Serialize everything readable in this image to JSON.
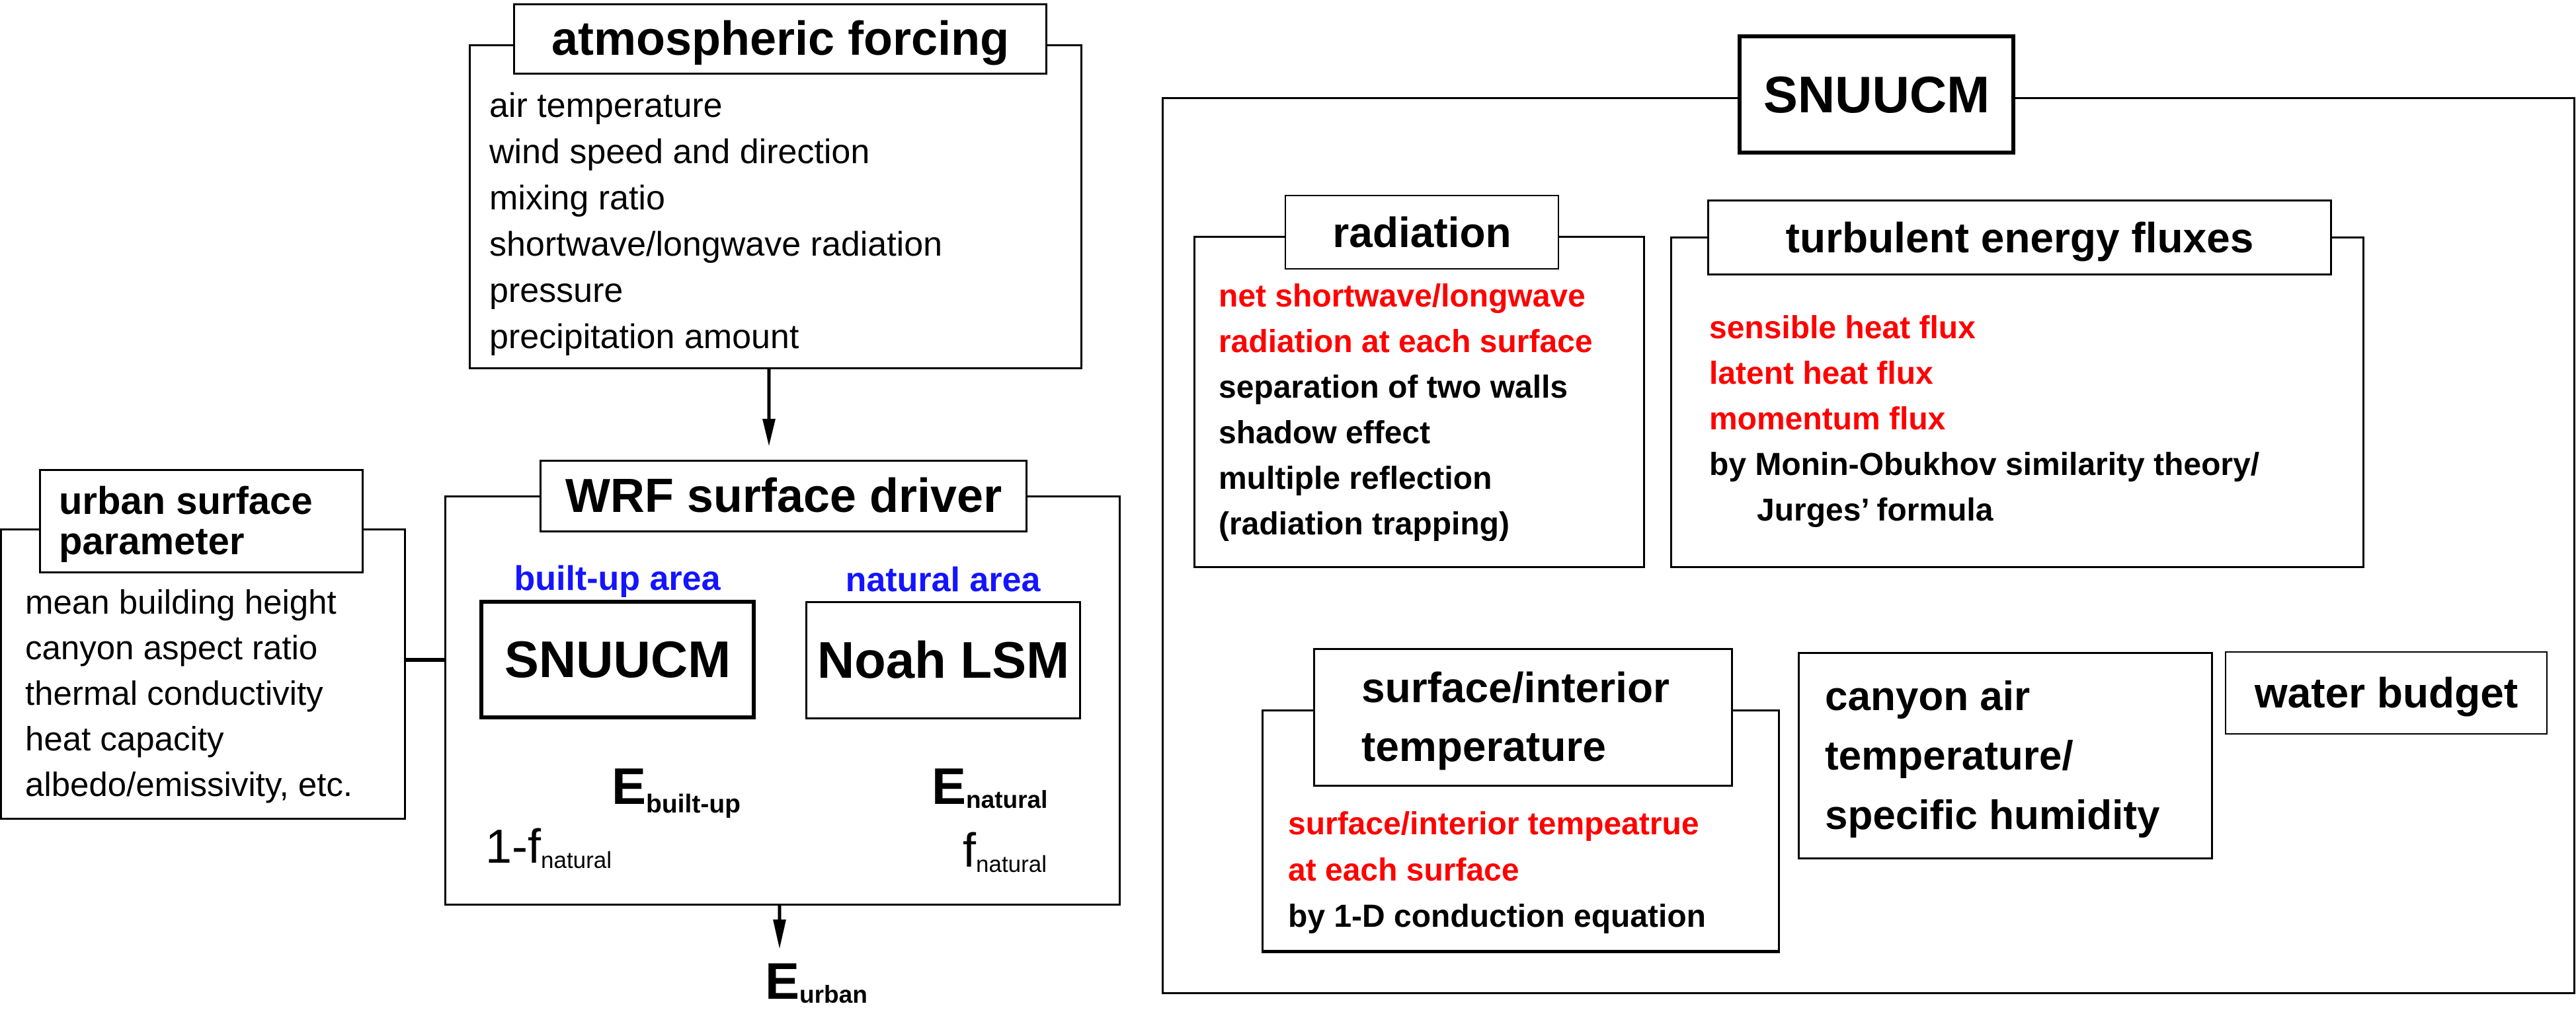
{
  "colors": {
    "line": "#000000",
    "highlight_red": "#ff0000",
    "label_blue": "#1414ff",
    "background": "#ffffff"
  },
  "atmospheric_forcing": {
    "title": "atmospheric forcing",
    "items": [
      "air temperature",
      "wind speed and direction",
      "mixing ratio",
      "shortwave/longwave radiation",
      "pressure",
      "precipitation amount"
    ]
  },
  "urban_surface_parameter": {
    "title_line1": "urban surface",
    "title_line2": "parameter",
    "items": [
      "mean building height",
      "canyon aspect ratio",
      "thermal conductivity",
      "heat capacity",
      "albedo/emissivity, etc."
    ]
  },
  "wrf_driver": {
    "title": "WRF surface driver",
    "builtup_label": "built-up area",
    "natural_label": "natural area",
    "builtup_model": "SNUUCM",
    "natural_model": "Noah LSM",
    "e_symbol": "E",
    "e_builtup_sub": "built-up",
    "e_natural_sub": "natural",
    "weight_builtup_main": "1-f",
    "weight_builtup_sub": "natural",
    "weight_natural_main": "f",
    "weight_natural_sub": "natural",
    "e_urban_sub": "urban"
  },
  "snuucm": {
    "title": "SNUUCM",
    "radiation": {
      "title": "radiation",
      "items": [
        {
          "text": "net shortwave/longwave",
          "highlight": true
        },
        {
          "text": "radiation at each surface",
          "highlight": true
        },
        {
          "text": "separation of two walls",
          "highlight": false
        },
        {
          "text": "shadow effect",
          "highlight": false
        },
        {
          "text": "multiple reflection",
          "highlight": false
        },
        {
          "text": "(radiation trapping)",
          "highlight": false
        }
      ]
    },
    "turbulent": {
      "title": "turbulent energy fluxes",
      "items": [
        {
          "text": "sensible heat flux",
          "highlight": true
        },
        {
          "text": "latent heat flux",
          "highlight": true
        },
        {
          "text": "momentum flux",
          "highlight": true
        },
        {
          "text": "by Monin-Obukhov similarity theory/",
          "highlight": false
        },
        {
          "text": "Jurges’ formula",
          "highlight": false
        }
      ]
    },
    "surface_interior": {
      "title_line1": "surface/interior",
      "title_line2": "temperature",
      "items": [
        {
          "text": "surface/interior tempeatrue",
          "highlight": true
        },
        {
          "text": "at each surface",
          "highlight": true
        },
        {
          "text": "by 1-D conduction equation",
          "highlight": false
        }
      ]
    },
    "canyon": {
      "lines": [
        "canyon air",
        "temperature/",
        "specific humidity"
      ]
    },
    "water_budget": {
      "title": "water budget"
    }
  }
}
